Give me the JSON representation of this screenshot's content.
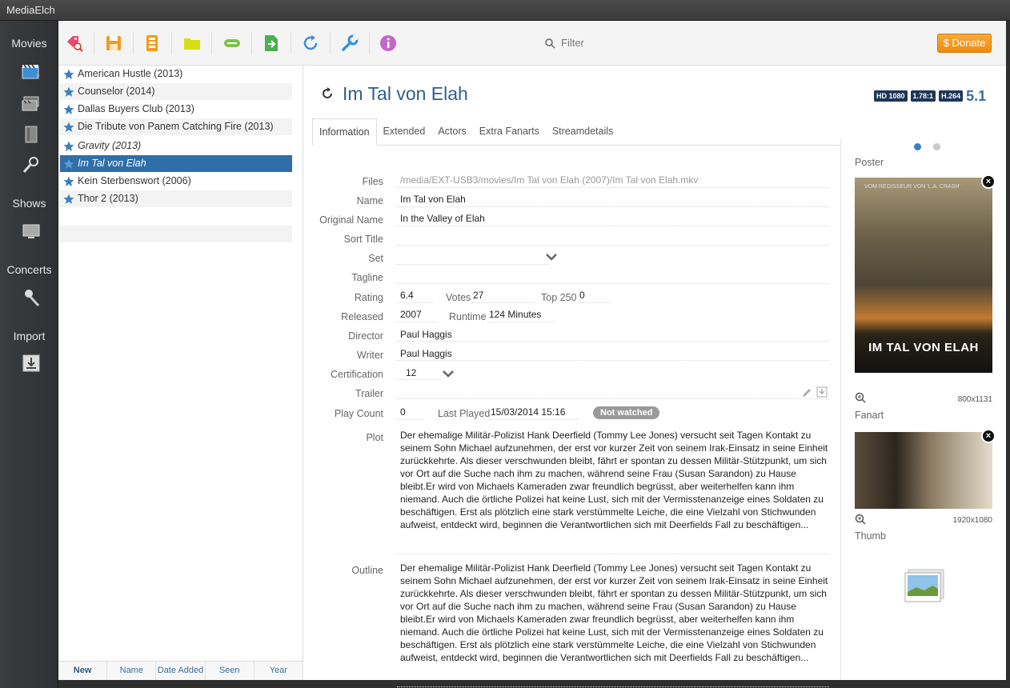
{
  "window": {
    "title": "MediaElch"
  },
  "nav": {
    "movies": "Movies",
    "shows": "Shows",
    "concerts": "Concerts",
    "import": "Import"
  },
  "toolbar": {
    "filter_placeholder": "Filter",
    "donate_label": "$ Donate",
    "icons": [
      "tag-search-icon",
      "save-icon",
      "save-all-icon",
      "open-folder-icon",
      "rename-icon",
      "export-icon",
      "reload-icon",
      "settings-icon",
      "about-icon"
    ]
  },
  "movies": [
    {
      "title": "American Hustle (2013)"
    },
    {
      "title": "Counselor (2014)"
    },
    {
      "title": "Dallas Buyers Club (2013)"
    },
    {
      "title": "Die Tribute von Panem Catching Fire (2013)"
    },
    {
      "title": "Gravity (2013)"
    },
    {
      "title": "Im Tal von Elah"
    },
    {
      "title": "Kein Sterbenswort (2006)"
    },
    {
      "title": "Thor 2 (2013)"
    }
  ],
  "sort_tabs": [
    "New",
    "Name",
    "Date Added",
    "Seen",
    "Year"
  ],
  "detail": {
    "title": "Im Tal von Elah",
    "badges": {
      "hd": "HD 1080",
      "aspect": "1.78:1",
      "codec": "H.264",
      "audio": "5.1"
    },
    "tabs": [
      "Information",
      "Extended",
      "Actors",
      "Extra Fanarts",
      "Streamdetails"
    ],
    "labels": {
      "files": "Files",
      "name": "Name",
      "original_name": "Original Name",
      "sort_title": "Sort Title",
      "set": "Set",
      "tagline": "Tagline",
      "rating": "Rating",
      "votes": "Votes",
      "top250": "Top 250",
      "released": "Released",
      "runtime": "Runtime",
      "director": "Director",
      "writer": "Writer",
      "certification": "Certification",
      "trailer": "Trailer",
      "play_count": "Play Count",
      "last_played": "Last Played",
      "plot": "Plot",
      "outline": "Outline"
    },
    "values": {
      "files": "/media/EXT-USB3/movies/Im Tal von Elah (2007)/Im Tal von Elah.mkv",
      "name": "Im Tal von Elah",
      "original_name": "In the Valley of Elah",
      "sort_title": "",
      "set": "",
      "tagline": "",
      "rating": "6.4",
      "votes": "27",
      "top250": "0",
      "released": "2007",
      "runtime": "124 Minutes",
      "director": "Paul Haggis",
      "writer": "Paul Haggis",
      "certification": "12",
      "trailer": "",
      "play_count": "0",
      "last_played": "15/03/2014 15:16",
      "watched_status": "Not watched",
      "plot": "Der ehemalige Militär-Polizist Hank Deerfield (Tommy Lee Jones) versucht seit Tagen Kontakt zu seinem Sohn Michael aufzunehmen, der erst vor kurzer Zeit von seinem Irak-Einsatz in seine Einheit zurückkehrte. Als dieser verschwunden bleibt, fährt er spontan zu dessen Militär-Stützpunkt, um sich vor Ort auf die Suche nach ihm zu machen, während seine Frau (Susan Sarandon) zu Hause bleibt.Er wird von Michaels Kameraden zwar freundlich begrüsst, aber weiterhelfen kann ihm niemand. Auch die örtliche Polizei hat keine Lust, sich mit der Vermisstenanzeige eines Soldaten zu beschäftigen. Erst als plötzlich eine stark verstümmelte Leiche, die eine Vielzahl von Stichwunden aufweist, entdeckt wird, beginnen die Verantwortlichen sich mit Deerfields Fall zu beschäftigen...",
      "outline": "Der ehemalige Militär-Polizist Hank Deerfield (Tommy Lee Jones) versucht seit Tagen Kontakt zu seinem Sohn Michael aufzunehmen, der erst vor kurzer Zeit von seinem Irak-Einsatz in seine Einheit zurückkehrte. Als dieser verschwunden bleibt, fährt er spontan zu dessen Militär-Stützpunkt, um sich vor Ort auf die Suche nach ihm zu machen, während seine Frau (Susan Sarandon) zu Hause bleibt.Er wird von Michaels Kameraden zwar freundlich begrüsst, aber weiterhelfen kann ihm niemand. Auch die örtliche Polizei hat keine Lust, sich mit der Vermisstenanzeige eines Soldaten zu beschäftigen. Erst als plötzlich eine stark verstümmelte Leiche, die eine Vielzahl von Stichwunden aufweist, entdeckt wird, beginnen die Verantwortlichen sich mit Deerfields Fall zu beschäftigen..."
    }
  },
  "images": {
    "poster_label": "Poster",
    "poster_res": "800x1131",
    "poster_tagline": "VOM REGISSEUR VON 'L.A. CRASH'",
    "poster_title": "IM TAL VON ELAH",
    "fanart_label": "Fanart",
    "fanart_res": "1920x1080",
    "thumb_label": "Thumb"
  },
  "colors": {
    "accent": "#2f6ea7",
    "donate": "#f39a1e",
    "title": "#2f5f8a"
  }
}
